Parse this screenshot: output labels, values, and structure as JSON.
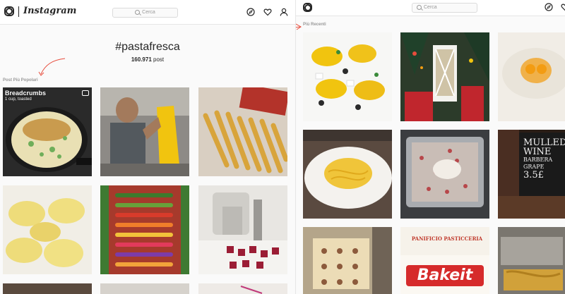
{
  "left": {
    "brand": "Instagram",
    "search_placeholder": "Cerca",
    "hashtag": "#pastafresca",
    "post_count_value": "160.971",
    "post_count_label": "post",
    "section_label": "Post Più Popolari",
    "tile1_title": "Breadcrumbs",
    "tile1_subtitle": "1 cup, toasted"
  },
  "right": {
    "search_placeholder": "Cerca",
    "section_label": "Più Recenti",
    "mulled_line1": "MULLED",
    "mulled_line2": "WINE",
    "mulled_line3": "BARBERA",
    "mulled_line4": "GRAPE",
    "mulled_price": "3.5£",
    "bake_heading": "PANIFICIO PASTICCERIA",
    "bake_logo": "Bakeit"
  },
  "colors": {
    "arrow": "#e74c3c",
    "text": "#262626",
    "muted": "#999999",
    "border": "#e6e6e6"
  },
  "icons": [
    "instagram-logo-icon",
    "search-icon",
    "compass-icon",
    "heart-icon",
    "user-icon"
  ]
}
